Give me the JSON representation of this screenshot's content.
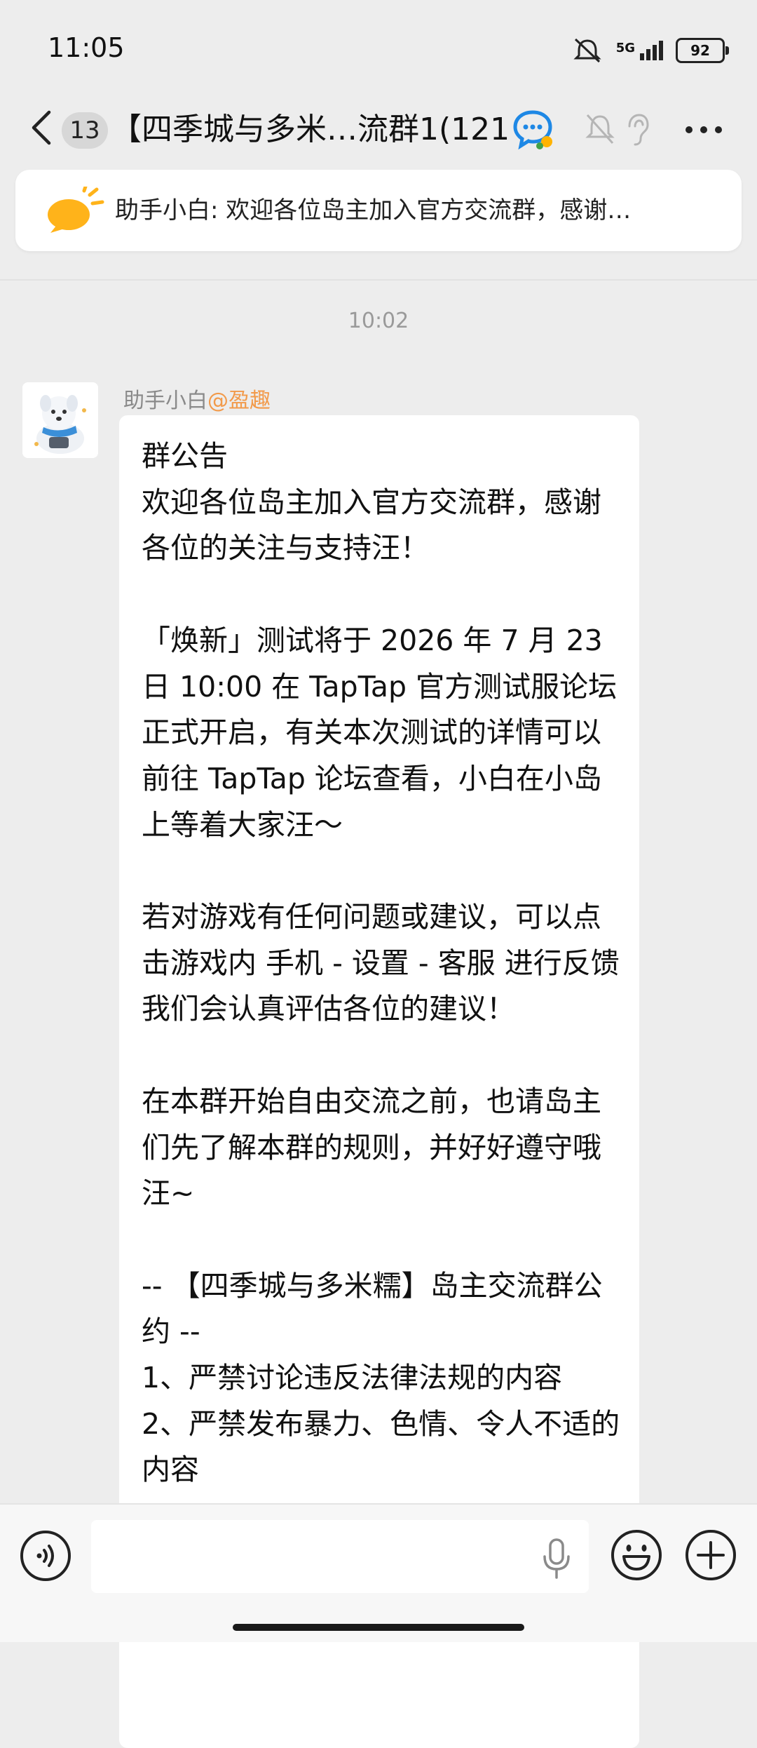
{
  "status_bar": {
    "time": "11:05",
    "network": "5G",
    "battery": "92"
  },
  "nav": {
    "unread_count": "13",
    "title": "【四季城与多米…流群1(121)",
    "icons": [
      "back-icon",
      "group-type-icon",
      "mute-icon",
      "ear-icon",
      "more-icon"
    ]
  },
  "pinned": {
    "text": "助手小白: 欢迎各位岛主加入官方交流群，感谢…"
  },
  "timestamp": "10:02",
  "message": {
    "sender_name": "助手小白",
    "sender_tag": "@盈趣",
    "text": "群公告\n欢迎各位岛主加入官方交流群，感谢各位的关注与支持汪！\n\n「焕新」测试将于 2026 年 7 月 23 日 10:00 在 TapTap 官方测试服论坛正式开启，有关本次测试的详情可以前往 TapTap 论坛查看，小白在小岛上等着大家汪～\n\n若对游戏有任何问题或建议，可以点击游戏内 手机 - 设置 - 客服 进行反馈我们会认真评估各位的建议！\n\n在本群开始自由交流之前，也请岛主们先了解本群的规则，并好好遵守哦汪~\n\n-- 【四季城与多米糯】岛主交流群公约 --\n1、严禁讨论违反法律法规的内容\n2、严禁发布暴力、色情、令人不适的内容"
  },
  "input_bar": {
    "placeholder": "",
    "icons": [
      "voice-icon",
      "mic-icon",
      "emoji-icon",
      "plus-icon"
    ]
  },
  "colors": {
    "background": "#ededed",
    "bubble": "#ffffff",
    "sender_tag": "#f29a4a",
    "badge": "#d7d7d7"
  }
}
